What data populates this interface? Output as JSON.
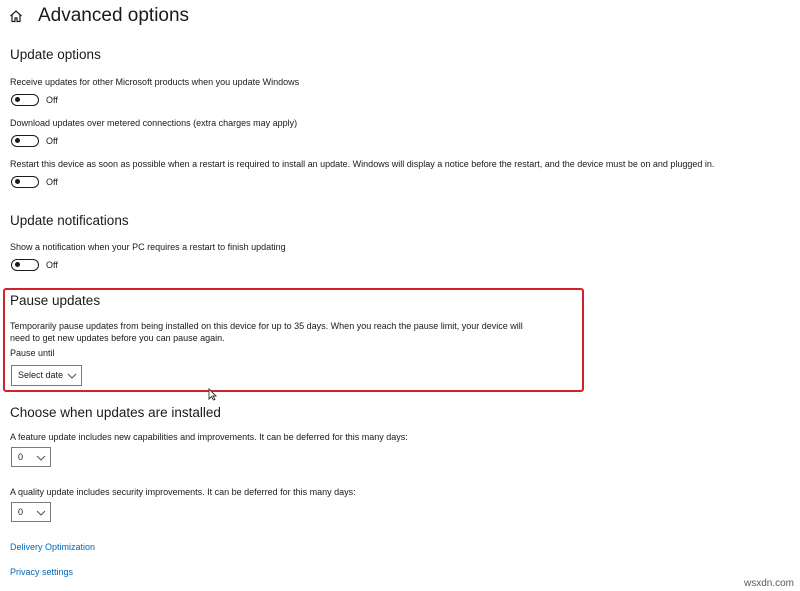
{
  "header": {
    "title": "Advanced options"
  },
  "update_options": {
    "title": "Update options",
    "items": [
      {
        "text": "Receive updates for other Microsoft products when you update Windows",
        "state": "Off"
      },
      {
        "text": "Download updates over metered connections (extra charges may apply)",
        "state": "Off"
      },
      {
        "text": "Restart this device as soon as possible when a restart is required to install an update. Windows will display a notice before the restart, and the device must be on and plugged in.",
        "state": "Off"
      }
    ]
  },
  "update_notifications": {
    "title": "Update notifications",
    "items": [
      {
        "text": "Show a notification when your PC requires a restart to finish updating",
        "state": "Off"
      }
    ]
  },
  "pause_updates": {
    "title": "Pause updates",
    "description": "Temporarily pause updates from being installed on this device for up to 35 days. When you reach the pause limit, your device will need to get new updates before you can pause again.",
    "pause_until_label": "Pause until",
    "select_date": "Select date",
    "highlight_color": "#d2232a"
  },
  "choose_updates": {
    "title": "Choose when updates are installed",
    "feature_text": "A feature update includes new capabilities and improvements. It can be deferred for this many days:",
    "feature_value": "0",
    "quality_text": "A quality update includes security improvements. It can be deferred for this many days:",
    "quality_value": "0"
  },
  "links": {
    "delivery_optimization": "Delivery Optimization",
    "privacy_settings": "Privacy settings",
    "link_color": "#0067b8"
  },
  "watermark": "wsxdn.com",
  "icons": {
    "home": "home-icon",
    "chevron": "chevron-down-icon",
    "cursor": "mouse-cursor-icon"
  }
}
